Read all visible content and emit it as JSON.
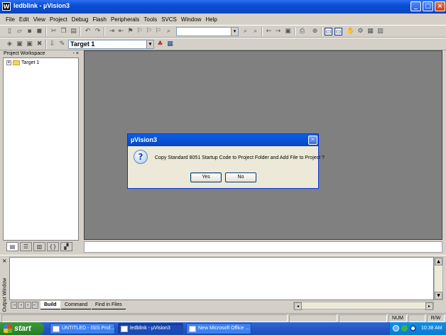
{
  "window": {
    "title": "ledblink - µVision3",
    "app_icon": "W"
  },
  "title_buttons": {
    "minimize": "_",
    "maximize": "□",
    "close": "×"
  },
  "menu": [
    "File",
    "Edit",
    "View",
    "Project",
    "Debug",
    "Flash",
    "Peripherals",
    "Tools",
    "SVCS",
    "Window",
    "Help"
  ],
  "toolbar": {
    "target": "Target 1",
    "combo_arrow": "▾"
  },
  "workspace": {
    "title": "Project Workspace",
    "controls": "- ×",
    "tree_root": "Target 1",
    "tabs": [
      "files-tab",
      "regs-tab",
      "books-tab",
      "functions-tab",
      "templates-tab"
    ]
  },
  "dialog": {
    "title": "µVision3",
    "message": "Copy Standard 8051 Startup Code to Project Folder and Add File to Project ?",
    "yes": "Yes",
    "no": "No",
    "close": "×",
    "icon": "?"
  },
  "output": {
    "title": "Output Window",
    "close": "×",
    "tabs": [
      "Build",
      "Command",
      "Find in Files"
    ],
    "active_tab": "Build"
  },
  "statusbar": {
    "num": "NUM",
    "rw": "R/W"
  },
  "taskbar": {
    "start": "start",
    "tasks": [
      "UNTITLED - ISIS Prof...",
      "ledblink - µVision3",
      "New Microsoft Office ..."
    ],
    "clock": "10:38 AM"
  },
  "colors": {
    "mdi_background": "#808080",
    "title_blue": "#0a4fd6",
    "start_green": "#2f8a2f"
  }
}
